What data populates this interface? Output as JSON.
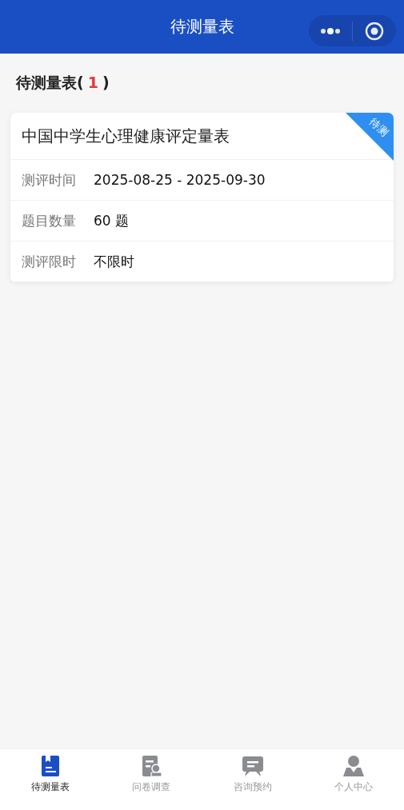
{
  "nav_bar": {
    "title": "待测量表"
  },
  "heading": {
    "label": "待测量表(",
    "count": "1",
    "close": ")"
  },
  "cards": [
    {
      "title": "中国中学生心理健康评定量表",
      "badge": "待测",
      "fields": [
        {
          "label": "测评时间",
          "value": "2025-08-25 - 2025-09-30"
        },
        {
          "label": "题目数量",
          "value": "60 题"
        },
        {
          "label": "测评限时",
          "value": "不限时"
        }
      ]
    }
  ],
  "tab_bar": [
    {
      "kind": "book",
      "label": "待测量表",
      "selected": true
    },
    {
      "kind": "form",
      "label": "问卷调查",
      "selected": false
    },
    {
      "kind": "chat",
      "label": "咨询预约",
      "selected": false
    },
    {
      "kind": "person",
      "label": "个人中心",
      "selected": false
    }
  ]
}
